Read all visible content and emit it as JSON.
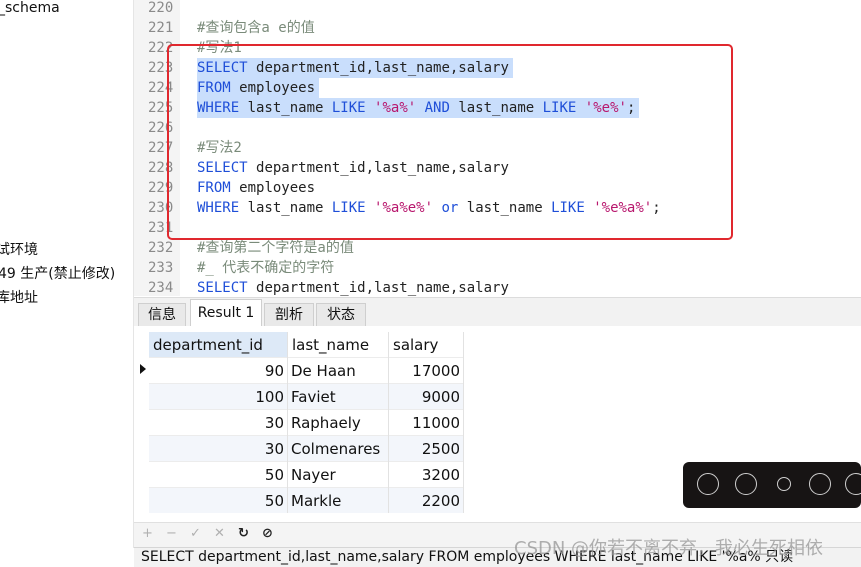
{
  "sidebar": {
    "items": [
      "_schema",
      "试环境",
      "49 生产(禁止修改)",
      "库地址"
    ]
  },
  "editor": {
    "lines": [
      {
        "no": "220",
        "parts": []
      },
      {
        "no": "221",
        "parts": [
          {
            "t": "#查询包含a e的值",
            "c": "cm"
          }
        ]
      },
      {
        "no": "222",
        "parts": [
          {
            "t": "#写法1",
            "c": "cm"
          }
        ]
      },
      {
        "no": "223",
        "sel": true,
        "parts": [
          {
            "t": "SELECT ",
            "c": "kw"
          },
          {
            "t": "department_id,last_name,salary",
            "c": "tx"
          }
        ]
      },
      {
        "no": "224",
        "sel": true,
        "parts": [
          {
            "t": "FROM ",
            "c": "kw"
          },
          {
            "t": "employees",
            "c": "tx"
          }
        ]
      },
      {
        "no": "225",
        "sel": true,
        "parts": [
          {
            "t": "WHERE ",
            "c": "kw"
          },
          {
            "t": "last_name ",
            "c": "tx"
          },
          {
            "t": "LIKE ",
            "c": "kw"
          },
          {
            "t": "'%a%' ",
            "c": "str"
          },
          {
            "t": "AND ",
            "c": "kw"
          },
          {
            "t": "last_name ",
            "c": "tx"
          },
          {
            "t": "LIKE ",
            "c": "kw"
          },
          {
            "t": "'%e%'",
            "c": "str"
          },
          {
            "t": ";",
            "c": "tx"
          }
        ]
      },
      {
        "no": "226",
        "parts": []
      },
      {
        "no": "227",
        "parts": [
          {
            "t": "#写法2",
            "c": "cm"
          }
        ]
      },
      {
        "no": "228",
        "parts": [
          {
            "t": "SELECT ",
            "c": "kw"
          },
          {
            "t": "department_id,last_name,salary",
            "c": "tx"
          }
        ]
      },
      {
        "no": "229",
        "parts": [
          {
            "t": "FROM ",
            "c": "kw"
          },
          {
            "t": "employees",
            "c": "tx"
          }
        ]
      },
      {
        "no": "230",
        "parts": [
          {
            "t": "WHERE ",
            "c": "kw"
          },
          {
            "t": "last_name ",
            "c": "tx"
          },
          {
            "t": "LIKE ",
            "c": "kw"
          },
          {
            "t": "'%a%e%' ",
            "c": "str"
          },
          {
            "t": "or ",
            "c": "kw"
          },
          {
            "t": "last_name ",
            "c": "tx"
          },
          {
            "t": "LIKE ",
            "c": "kw"
          },
          {
            "t": "'%e%a%'",
            "c": "str"
          },
          {
            "t": ";",
            "c": "tx"
          }
        ]
      },
      {
        "no": "231",
        "parts": []
      },
      {
        "no": "232",
        "parts": [
          {
            "t": "#查询第二个字符是a的值",
            "c": "cm"
          }
        ]
      },
      {
        "no": "233",
        "parts": [
          {
            "t": "#_ 代表不确定的字符",
            "c": "cm"
          }
        ]
      },
      {
        "no": "234",
        "parts": [
          {
            "t": "SELECT ",
            "c": "kw"
          },
          {
            "t": "department_id,last_name,salary",
            "c": "tx"
          }
        ]
      }
    ]
  },
  "tabs": [
    "信息",
    "Result 1",
    "剖析",
    "状态"
  ],
  "active_tab": 1,
  "grid": {
    "columns": [
      "department_id",
      "last_name",
      "salary"
    ],
    "rows": [
      [
        "90",
        "De Haan",
        "17000"
      ],
      [
        "100",
        "Faviet",
        "9000"
      ],
      [
        "30",
        "Raphaely",
        "11000"
      ],
      [
        "30",
        "Colmenares",
        "2500"
      ],
      [
        "50",
        "Nayer",
        "3200"
      ],
      [
        "50",
        "Markle",
        "2200"
      ]
    ]
  },
  "toolbar": {
    "buttons": [
      {
        "icon": "+",
        "name": "add-row-icon",
        "enabled": false
      },
      {
        "icon": "−",
        "name": "delete-row-icon",
        "enabled": false
      },
      {
        "icon": "✓",
        "name": "apply-icon",
        "enabled": false
      },
      {
        "icon": "✕",
        "name": "discard-icon",
        "enabled": false
      },
      {
        "icon": "↻",
        "name": "refresh-icon",
        "enabled": true
      },
      {
        "icon": "⊘",
        "name": "stop-icon",
        "enabled": true
      }
    ]
  },
  "statusbar": {
    "text": "SELECT department_id,last_name,salary FROM employees WHERE last_name LIKE '%a% 只读"
  },
  "watermark": "CSDN @你若不离不弃，我必生死相依",
  "colors": {
    "keyword": "#1f4fd8",
    "string": "#b8176d",
    "comment": "#7a8b7a",
    "selection": "#c9defc",
    "highlight_box": "#e0282e"
  }
}
